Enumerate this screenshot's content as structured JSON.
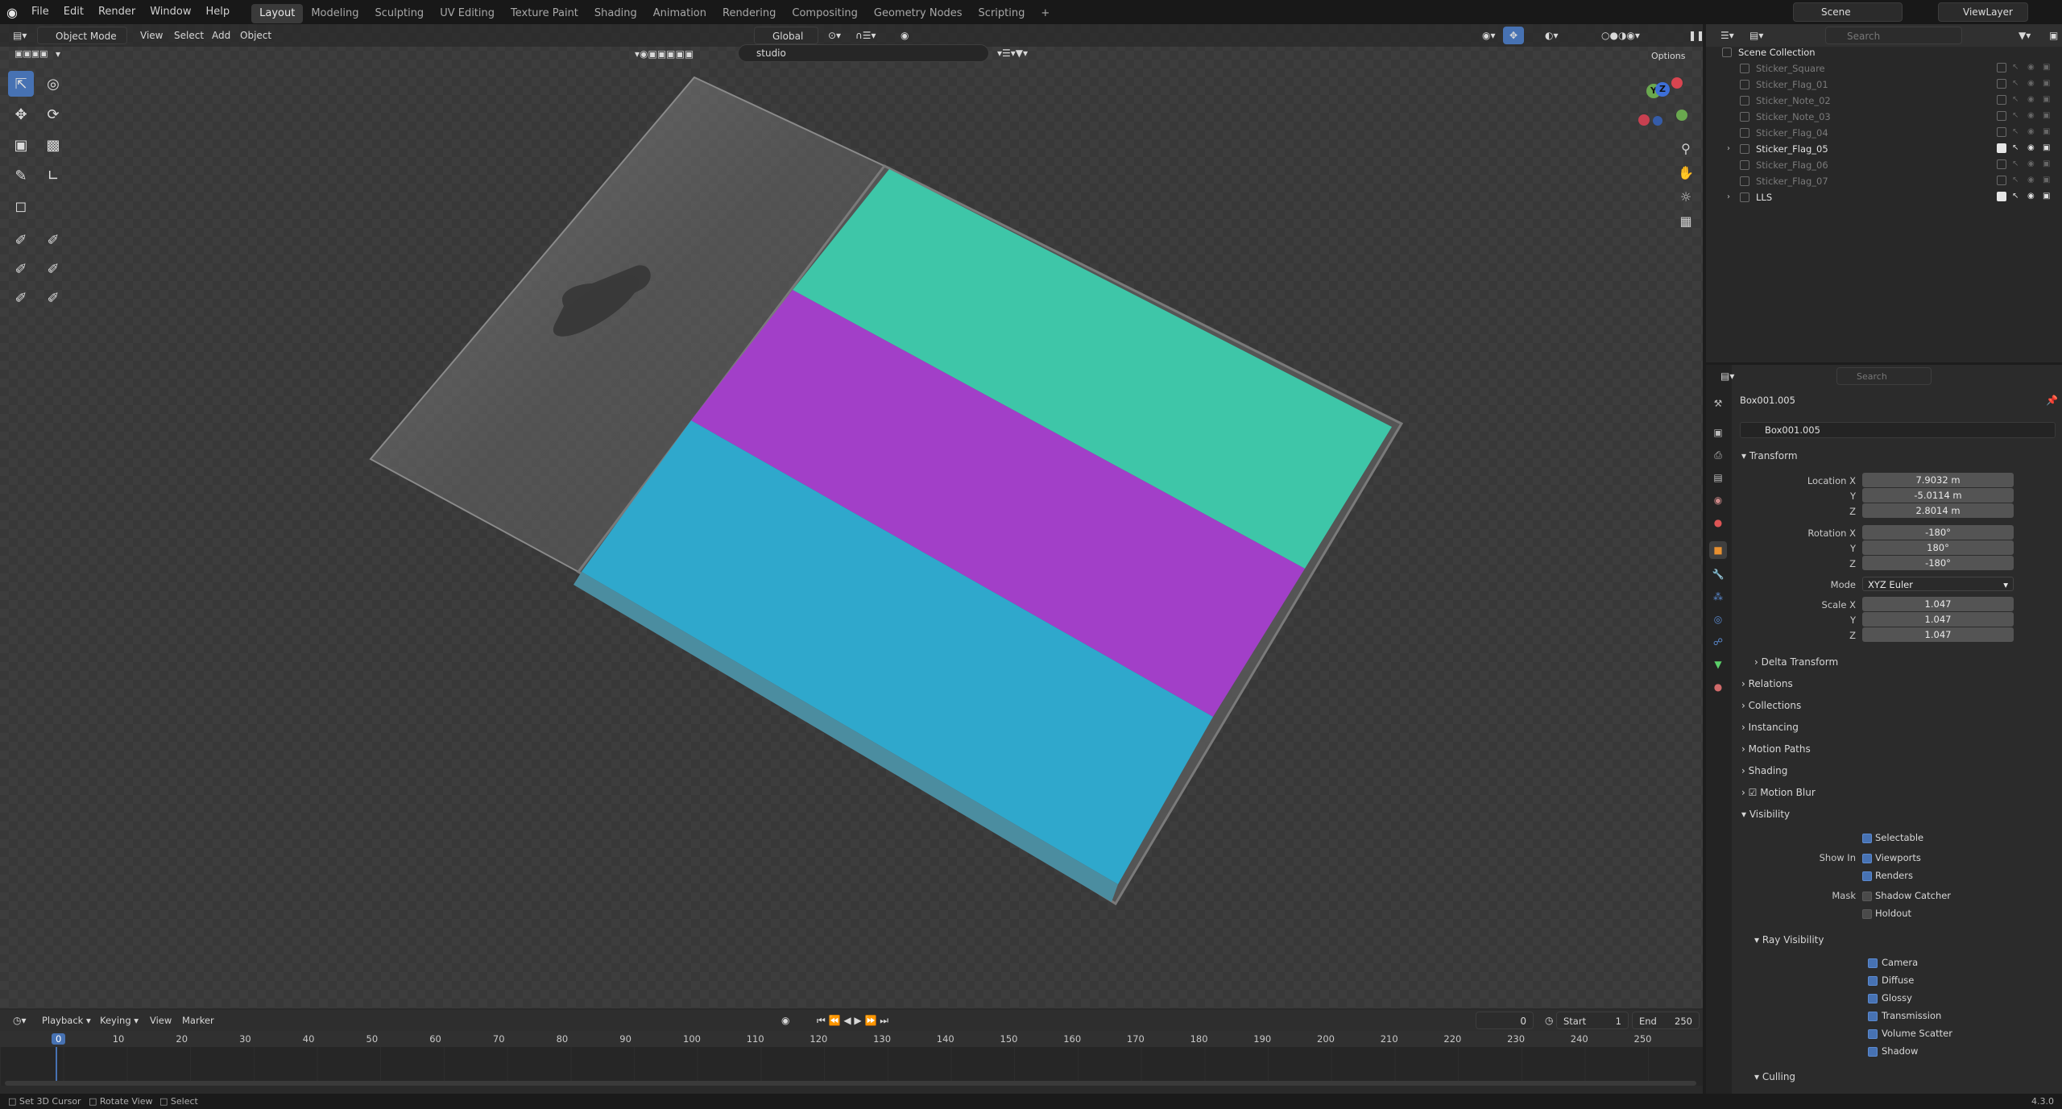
{
  "topbar": {
    "menus": [
      "File",
      "Edit",
      "Render",
      "Window",
      "Help"
    ],
    "workspaces": [
      "Layout",
      "Modeling",
      "Sculpting",
      "UV Editing",
      "Texture Paint",
      "Shading",
      "Animation",
      "Rendering",
      "Compositing",
      "Geometry Nodes",
      "Scripting",
      "+"
    ],
    "active_workspace": "Layout",
    "scene": "Scene",
    "view_layer": "ViewLayer"
  },
  "viewport_header": {
    "mode": "Object Mode",
    "menus": [
      "View",
      "Select",
      "Add",
      "Object"
    ],
    "orientation": "Global",
    "options": "Options",
    "hdri_search": "studio"
  },
  "outliner": {
    "search_placeholder": "Search",
    "collection": "Scene Collection",
    "items": [
      {
        "name": "Sticker_Square",
        "visible": false
      },
      {
        "name": "Sticker_Flag_01",
        "visible": false
      },
      {
        "name": "Sticker_Note_02",
        "visible": false
      },
      {
        "name": "Sticker_Note_03",
        "visible": false
      },
      {
        "name": "Sticker_Flag_04",
        "visible": false
      },
      {
        "name": "Sticker_Flag_05",
        "visible": true
      },
      {
        "name": "Sticker_Flag_06",
        "visible": false
      },
      {
        "name": "Sticker_Flag_07",
        "visible": false
      },
      {
        "name": "LLS",
        "visible": true
      }
    ]
  },
  "properties": {
    "search_placeholder": "Search",
    "object_name": "Box001.005",
    "datablock": "Box001.005",
    "transform_title": "Transform",
    "location_label": "Location X",
    "location": [
      "7.9032 m",
      "-5.0114 m",
      "2.8014 m"
    ],
    "rotation_label": "Rotation X",
    "rotation": [
      "-180°",
      "180°",
      "-180°"
    ],
    "mode_label": "Mode",
    "mode_value": "XYZ Euler",
    "scale_label": "Scale X",
    "scale": [
      "1.047",
      "1.047",
      "1.047"
    ],
    "axis_y": "Y",
    "axis_z": "Z",
    "sections": [
      "Delta Transform",
      "Relations",
      "Collections",
      "Instancing",
      "Motion Paths",
      "Shading",
      "Motion Blur",
      "Visibility"
    ],
    "visibility": {
      "selectable": "Selectable",
      "show_in": "Show In",
      "viewports": "Viewports",
      "renders": "Renders",
      "mask": "Mask",
      "shadow_catcher": "Shadow Catcher",
      "holdout": "Holdout",
      "ray_visibility": "Ray Visibility",
      "rays": [
        "Camera",
        "Diffuse",
        "Glossy",
        "Transmission",
        "Volume Scatter",
        "Shadow"
      ],
      "culling": "Culling"
    }
  },
  "timeline": {
    "menus": [
      "Playback",
      "Keying",
      "View",
      "Marker"
    ],
    "current_frame": "0",
    "start_label": "Start",
    "start": "1",
    "end_label": "End",
    "end": "250",
    "ticks": [
      "0",
      "10",
      "20",
      "30",
      "40",
      "50",
      "60",
      "70",
      "80",
      "90",
      "100",
      "110",
      "120",
      "130",
      "140",
      "150",
      "160",
      "170",
      "180",
      "190",
      "200",
      "210",
      "220",
      "230",
      "240",
      "250"
    ]
  },
  "statusbar": {
    "hints": [
      "Set 3D Cursor",
      "Rotate View",
      "Select"
    ],
    "version": "4.3.0"
  },
  "colors": {
    "accent": "#4772b3",
    "stripe_top": "#3ec6a8",
    "stripe_middle": "#a23fc8",
    "stripe_bottom": "#2fa8cc"
  }
}
